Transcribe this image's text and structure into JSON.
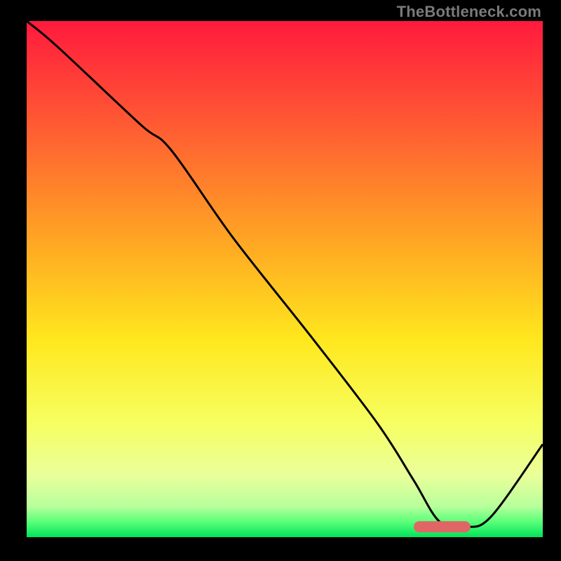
{
  "watermark": "TheBottleneck.com",
  "chart_data": {
    "type": "line",
    "title": "",
    "xlabel": "",
    "ylabel": "",
    "xlim": [
      0,
      100
    ],
    "ylim": [
      0,
      100
    ],
    "grid": false,
    "legend": false,
    "annotations": [],
    "background_gradient": {
      "stops": [
        {
          "pct": 0,
          "color": "#ff1a3d"
        },
        {
          "pct": 20,
          "color": "#ff5a33"
        },
        {
          "pct": 45,
          "color": "#ffae22"
        },
        {
          "pct": 62,
          "color": "#ffe81e"
        },
        {
          "pct": 78,
          "color": "#f6ff62"
        },
        {
          "pct": 88,
          "color": "#eaff9a"
        },
        {
          "pct": 94,
          "color": "#b8ff9c"
        },
        {
          "pct": 97,
          "color": "#5bff7a"
        },
        {
          "pct": 100,
          "color": "#00e35a"
        }
      ]
    },
    "series": [
      {
        "name": "bottleneck-curve",
        "x": [
          0,
          6,
          22,
          28,
          40,
          55,
          68,
          75,
          80,
          85,
          90,
          100
        ],
        "y": [
          100,
          95,
          80,
          75,
          58,
          39,
          22,
          11,
          3,
          2,
          4,
          18
        ]
      }
    ],
    "markers": [
      {
        "name": "optimal-band",
        "shape": "rounded-bar",
        "color": "#e06666",
        "x_start": 75,
        "x_end": 86,
        "y": 2
      }
    ]
  }
}
